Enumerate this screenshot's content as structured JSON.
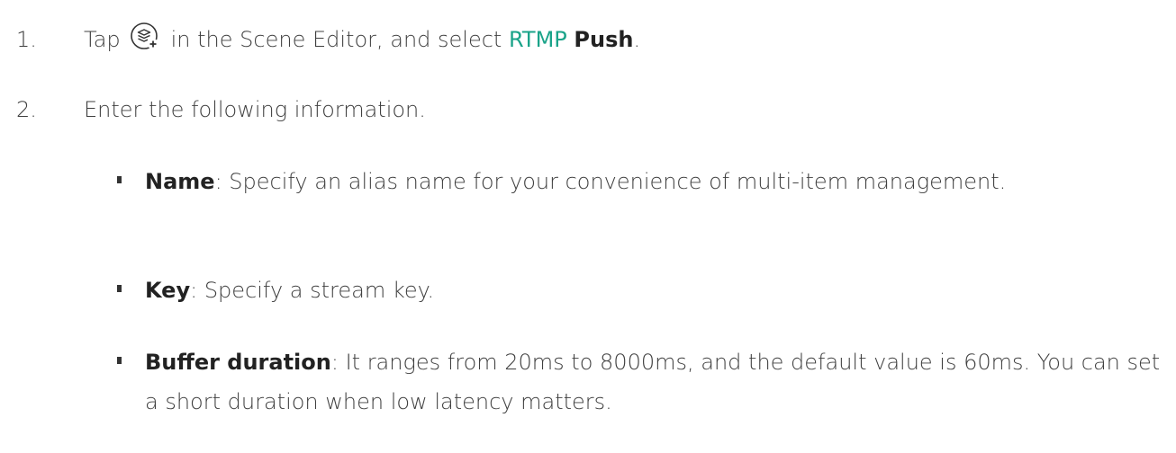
{
  "steps": [
    {
      "number": "1.",
      "before_icon": "Tap",
      "icon": "layers-add-icon",
      "after_icon": "in the Scene Editor, and select",
      "accent_word": "RTMP",
      "bold_word": "Push",
      "end": "."
    },
    {
      "number": "2.",
      "text": "Enter the following information."
    }
  ],
  "bullets": [
    {
      "term": "Name",
      "description": ": Specify an alias name for your convenience of multi-item management."
    },
    {
      "term": "Key",
      "description": ": Specify a stream key."
    },
    {
      "term": "Buffer duration",
      "description": ": It ranges from 20ms to 8000ms, and the default value is 60ms. You can set a short duration when low latency matters."
    }
  ],
  "colors": {
    "accent": "#1aa389",
    "text": "#3f3f3f",
    "term": "#222222"
  }
}
